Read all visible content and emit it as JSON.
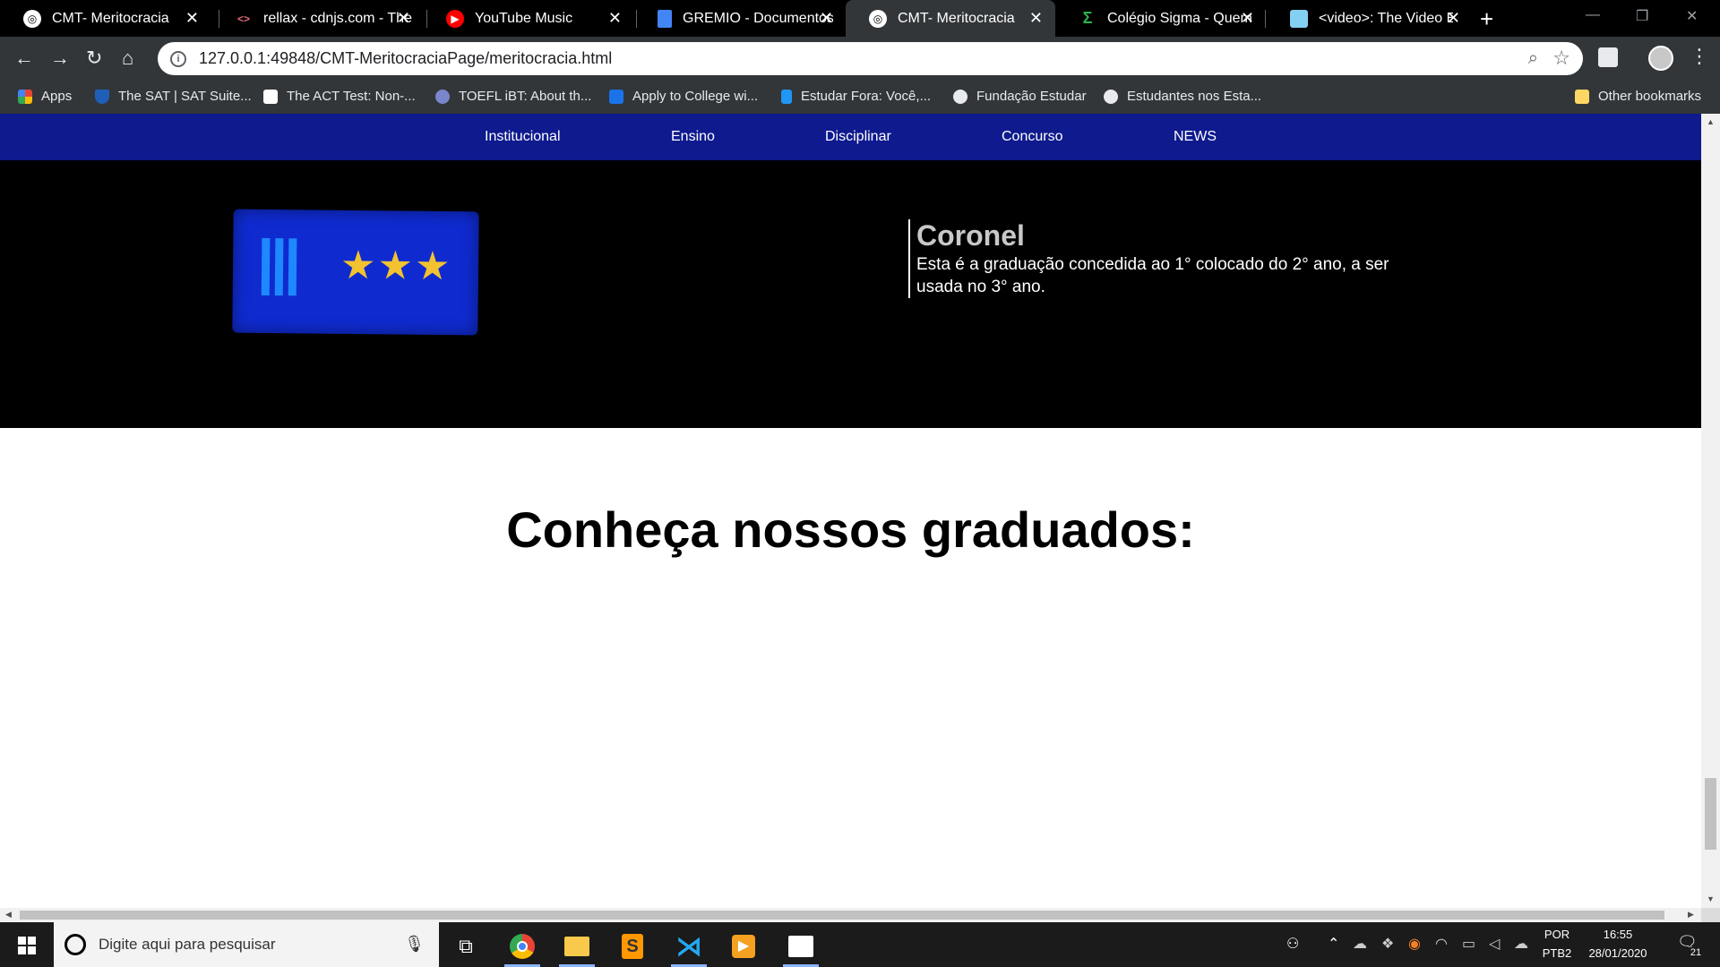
{
  "browser": {
    "tabs": [
      {
        "title": "CMT- Meritocracia",
        "active": false
      },
      {
        "title": "rellax - cdnjs.com - The",
        "active": false
      },
      {
        "title": "YouTube Music",
        "active": false
      },
      {
        "title": "GREMIO - Documentos",
        "active": false
      },
      {
        "title": "CMT- Meritocracia",
        "active": true
      },
      {
        "title": "Colégio Sigma - Quem",
        "active": false
      },
      {
        "title": "<video>: The Video Em",
        "active": false
      }
    ],
    "new_tab": "+",
    "url": "127.0.0.1:49848/CMT-MeritocraciaPage/meritocracia.html",
    "bookmarks": [
      "Apps",
      "The SAT | SAT Suite...",
      "The ACT Test: Non-...",
      "TOEFL iBT: About th...",
      "Apply to College wi...",
      "Estudar Fora: Você,...",
      "Fundação Estudar",
      "Estudantes nos Esta..."
    ],
    "other_bookmarks": "Other bookmarks"
  },
  "site": {
    "nav": [
      "Institucional",
      "Ensino",
      "Disciplinar",
      "Concurso",
      "NEWS"
    ],
    "rank": {
      "title": "Coronel",
      "description": "Esta é a graduação concedida ao 1° colocado do 2° ano, a ser usada no 3° ano."
    },
    "heading": "Conheça nossos graduados:"
  },
  "taskbar": {
    "search_placeholder": "Digite aqui para pesquisar",
    "lang_top": "POR",
    "lang_bottom": "PTB2",
    "time": "16:55",
    "date": "28/01/2020",
    "notifications": "21"
  },
  "colors": {
    "site_nav": "#0e1a8e",
    "patch": "#0f2bd0",
    "stars": "#f2c230",
    "rank_title": "#c8c8c8"
  }
}
